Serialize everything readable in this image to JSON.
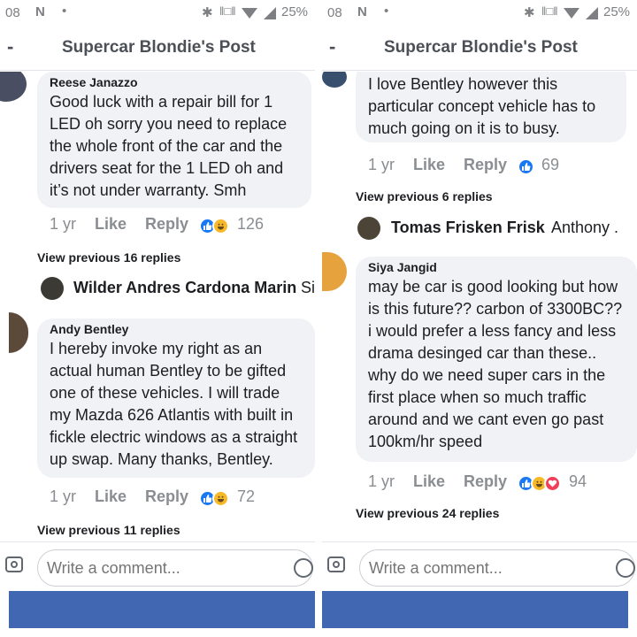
{
  "left": {
    "status": {
      "time": "08",
      "battery": "25%"
    },
    "header": {
      "back": "-",
      "title": "Supercar Blondie's Post"
    },
    "comment1": {
      "name": "Reese Janazzo",
      "lines": [
        "Good luck with a repair  bill for 1",
        "LED oh sorry you need to replace",
        "the whole front of the car and the",
        "drivers seat for the 1 LED oh and",
        "it’s not under warranty. Smh"
      ],
      "time": "1 yr",
      "like": "Like",
      "reply": "Reply",
      "count": "126"
    },
    "view_prev1": "View previous 16 replies",
    "reply1": {
      "name": "Wilder Andres Cardona Marin",
      "tag": "Si"
    },
    "comment2": {
      "name": "Andy Bentley",
      "lines": [
        "I hereby invoke my right as an",
        "actual human Bentley to be gifted",
        "one of these vehicles. I will trade",
        "my Mazda 626 Atlantis with built in",
        "fickle electric windows as a straight",
        "up swap. Many thanks, Bentley."
      ],
      "time": "1 yr",
      "like": "Like",
      "reply": "Reply",
      "count": "72"
    },
    "view_prev2": "View previous 11 replies",
    "composer": {
      "placeholder": "Write a comment..."
    }
  },
  "right": {
    "status": {
      "time": "08",
      "battery": "25%"
    },
    "header": {
      "back": "-",
      "title": "Supercar Blondie's Post"
    },
    "comment1": {
      "lines": [
        "I love Bentley however this",
        "particular concept vehicle has to",
        "much going on it is to busy."
      ],
      "time": "1 yr",
      "like": "Like",
      "reply": "Reply",
      "count": "69"
    },
    "view_prev1": "View previous 6 replies",
    "reply1": {
      "name": "Tomas Frisken Frisk",
      "tag": "Anthony ."
    },
    "comment2": {
      "name": "Siya Jangid",
      "lines": [
        "may be car is good looking but how",
        "is this future?? carbon of 3300BC??",
        "i would prefer a less fancy and less",
        "drama desinged car than these..",
        "why do we need super cars in the",
        "first place when so much traffic",
        "around and we cant even go past",
        "100km/hr speed"
      ],
      "time": "1 yr",
      "like": "Like",
      "reply": "Reply",
      "count": "94"
    },
    "view_prev2": "View previous 24 replies",
    "composer": {
      "placeholder": "Write a comment..."
    }
  },
  "colors": {
    "accent": "#4267b2",
    "like_blue": "#1877f2",
    "haha_yellow": "#f7b928",
    "love_red": "#f33e58",
    "bubble": "#f0f2f5"
  }
}
